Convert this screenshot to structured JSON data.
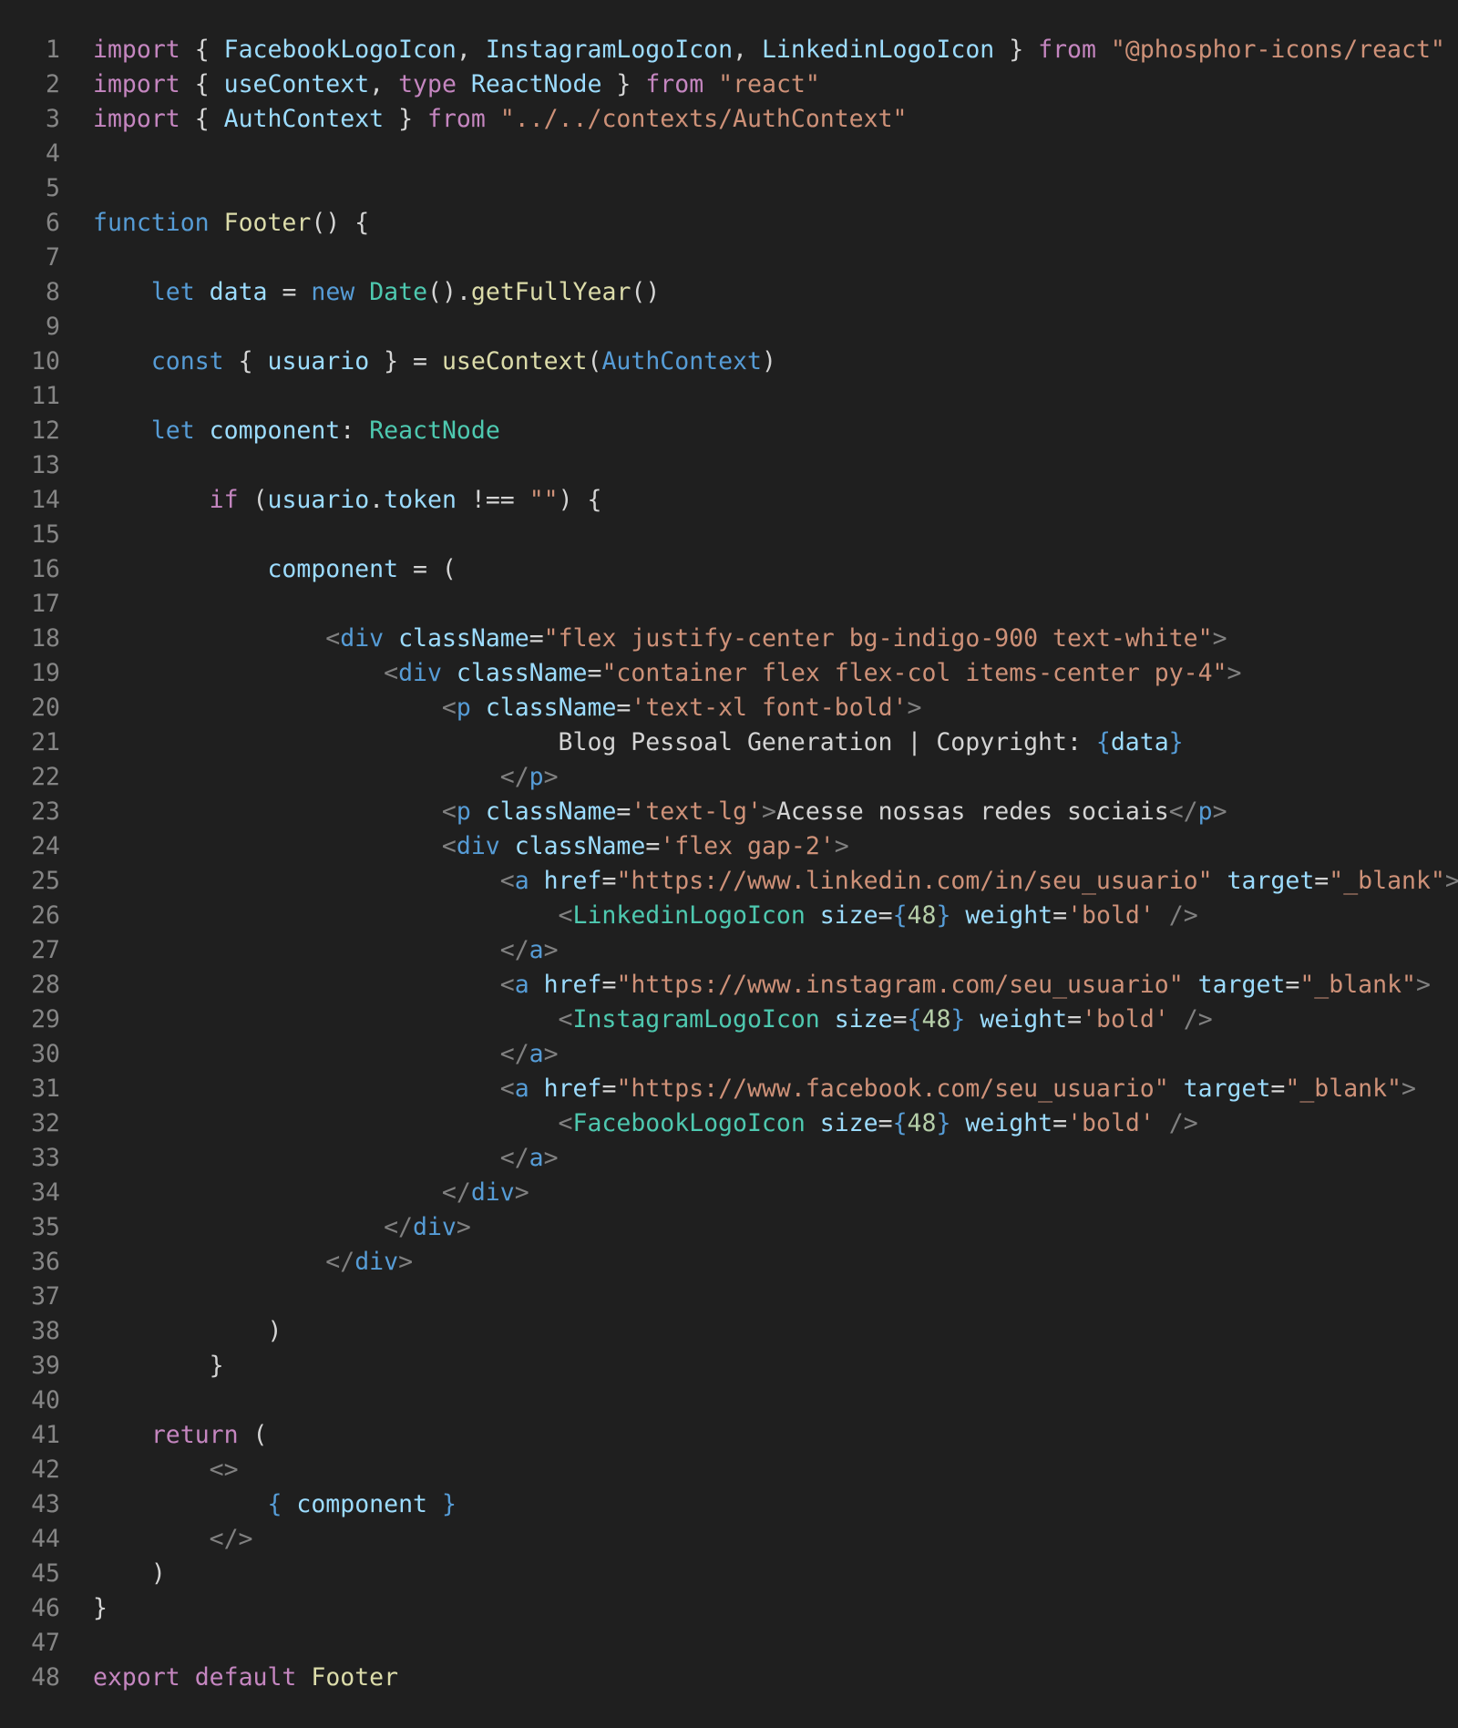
{
  "editor": {
    "theme": {
      "background": "#1f1f1f",
      "line_number": "#858585",
      "keyword_control": "#c586c0",
      "keyword_storage": "#569cd6",
      "variable": "#9cdcfe",
      "function": "#dcdcaa",
      "type": "#4ec9b0",
      "string": "#ce9178",
      "number": "#b5cea8",
      "punctuation": "#d4d4d4",
      "tag_bracket": "#808080"
    },
    "lines": [
      {
        "n": "1",
        "tokens": [
          [
            "k",
            "import"
          ],
          [
            "p",
            " { "
          ],
          [
            "v",
            "FacebookLogoIcon"
          ],
          [
            "p",
            ", "
          ],
          [
            "v",
            "InstagramLogoIcon"
          ],
          [
            "p",
            ", "
          ],
          [
            "v",
            "LinkedinLogoIcon"
          ],
          [
            "p",
            " } "
          ],
          [
            "k",
            "from"
          ],
          [
            "p",
            " "
          ],
          [
            "s",
            "\"@phosphor-icons/react\""
          ]
        ]
      },
      {
        "n": "2",
        "tokens": [
          [
            "k",
            "import"
          ],
          [
            "p",
            " { "
          ],
          [
            "v",
            "useContext"
          ],
          [
            "p",
            ", "
          ],
          [
            "k",
            "type"
          ],
          [
            "p",
            " "
          ],
          [
            "v",
            "ReactNode"
          ],
          [
            "p",
            " } "
          ],
          [
            "k",
            "from"
          ],
          [
            "p",
            " "
          ],
          [
            "s",
            "\"react\""
          ]
        ]
      },
      {
        "n": "3",
        "tokens": [
          [
            "k",
            "import"
          ],
          [
            "p",
            " { "
          ],
          [
            "v",
            "AuthContext"
          ],
          [
            "p",
            " } "
          ],
          [
            "k",
            "from"
          ],
          [
            "p",
            " "
          ],
          [
            "s",
            "\"../../contexts/AuthContext\""
          ]
        ]
      },
      {
        "n": "4",
        "tokens": []
      },
      {
        "n": "5",
        "tokens": []
      },
      {
        "n": "6",
        "tokens": [
          [
            "kb",
            "function"
          ],
          [
            "p",
            " "
          ],
          [
            "f",
            "Footer"
          ],
          [
            "p",
            "() {"
          ]
        ]
      },
      {
        "n": "7",
        "tokens": []
      },
      {
        "n": "8",
        "tokens": [
          [
            "p",
            "    "
          ],
          [
            "kb",
            "let"
          ],
          [
            "p",
            " "
          ],
          [
            "v",
            "data"
          ],
          [
            "p",
            " = "
          ],
          [
            "kb",
            "new"
          ],
          [
            "p",
            " "
          ],
          [
            "t",
            "Date"
          ],
          [
            "p",
            "()."
          ],
          [
            "f",
            "getFullYear"
          ],
          [
            "p",
            "()"
          ]
        ]
      },
      {
        "n": "9",
        "tokens": []
      },
      {
        "n": "10",
        "tokens": [
          [
            "p",
            "    "
          ],
          [
            "kb",
            "const"
          ],
          [
            "p",
            " { "
          ],
          [
            "v",
            "usuario"
          ],
          [
            "p",
            " } = "
          ],
          [
            "f",
            "useContext"
          ],
          [
            "p",
            "("
          ],
          [
            "kb",
            "AuthContext"
          ],
          [
            "p",
            ")"
          ]
        ]
      },
      {
        "n": "11",
        "tokens": []
      },
      {
        "n": "12",
        "tokens": [
          [
            "p",
            "    "
          ],
          [
            "kb",
            "let"
          ],
          [
            "p",
            " "
          ],
          [
            "v",
            "component"
          ],
          [
            "p",
            ": "
          ],
          [
            "t",
            "ReactNode"
          ]
        ]
      },
      {
        "n": "13",
        "tokens": []
      },
      {
        "n": "14",
        "tokens": [
          [
            "p",
            "        "
          ],
          [
            "k",
            "if"
          ],
          [
            "p",
            " ("
          ],
          [
            "v",
            "usuario"
          ],
          [
            "p",
            "."
          ],
          [
            "v",
            "token"
          ],
          [
            "p",
            " !== "
          ],
          [
            "s",
            "\"\""
          ],
          [
            "p",
            ") {"
          ]
        ]
      },
      {
        "n": "15",
        "tokens": []
      },
      {
        "n": "16",
        "tokens": [
          [
            "p",
            "            "
          ],
          [
            "v",
            "component"
          ],
          [
            "p",
            " = ("
          ]
        ]
      },
      {
        "n": "17",
        "tokens": []
      },
      {
        "n": "18",
        "tokens": [
          [
            "p",
            "                "
          ],
          [
            "tg",
            "<"
          ],
          [
            "tn",
            "div"
          ],
          [
            "p",
            " "
          ],
          [
            "v",
            "className"
          ],
          [
            "p",
            "="
          ],
          [
            "s",
            "\"flex justify-center bg-indigo-900 text-white\""
          ],
          [
            "tg",
            ">"
          ]
        ]
      },
      {
        "n": "19",
        "tokens": [
          [
            "p",
            "                    "
          ],
          [
            "tg",
            "<"
          ],
          [
            "tn",
            "div"
          ],
          [
            "p",
            " "
          ],
          [
            "v",
            "className"
          ],
          [
            "p",
            "="
          ],
          [
            "s",
            "\"container flex flex-col items-center py-4\""
          ],
          [
            "tg",
            ">"
          ]
        ]
      },
      {
        "n": "20",
        "tokens": [
          [
            "p",
            "                        "
          ],
          [
            "tg",
            "<"
          ],
          [
            "tn",
            "p"
          ],
          [
            "p",
            " "
          ],
          [
            "v",
            "className"
          ],
          [
            "p",
            "="
          ],
          [
            "s",
            "'text-xl font-bold'"
          ],
          [
            "tg",
            ">"
          ]
        ]
      },
      {
        "n": "21",
        "tokens": [
          [
            "p",
            "                                Blog Pessoal Generation | Copyright: "
          ],
          [
            "kb",
            "{"
          ],
          [
            "v",
            "data"
          ],
          [
            "kb",
            "}"
          ]
        ]
      },
      {
        "n": "22",
        "tokens": [
          [
            "p",
            "                            "
          ],
          [
            "tg",
            "</"
          ],
          [
            "tn",
            "p"
          ],
          [
            "tg",
            ">"
          ]
        ]
      },
      {
        "n": "23",
        "tokens": [
          [
            "p",
            "                        "
          ],
          [
            "tg",
            "<"
          ],
          [
            "tn",
            "p"
          ],
          [
            "p",
            " "
          ],
          [
            "v",
            "className"
          ],
          [
            "p",
            "="
          ],
          [
            "s",
            "'text-lg'"
          ],
          [
            "tg",
            ">"
          ],
          [
            "p",
            "Acesse nossas redes sociais"
          ],
          [
            "tg",
            "</"
          ],
          [
            "tn",
            "p"
          ],
          [
            "tg",
            ">"
          ]
        ]
      },
      {
        "n": "24",
        "tokens": [
          [
            "p",
            "                        "
          ],
          [
            "tg",
            "<"
          ],
          [
            "tn",
            "div"
          ],
          [
            "p",
            " "
          ],
          [
            "v",
            "className"
          ],
          [
            "p",
            "="
          ],
          [
            "s",
            "'flex gap-2'"
          ],
          [
            "tg",
            ">"
          ]
        ]
      },
      {
        "n": "25",
        "tokens": [
          [
            "p",
            "                            "
          ],
          [
            "tg",
            "<"
          ],
          [
            "tn",
            "a"
          ],
          [
            "p",
            " "
          ],
          [
            "v",
            "href"
          ],
          [
            "p",
            "="
          ],
          [
            "s",
            "\"https://www.linkedin.com/in/seu_usuario\""
          ],
          [
            "p",
            " "
          ],
          [
            "v",
            "target"
          ],
          [
            "p",
            "="
          ],
          [
            "s",
            "\"_blank\""
          ],
          [
            "tg",
            ">"
          ]
        ]
      },
      {
        "n": "26",
        "tokens": [
          [
            "p",
            "                                "
          ],
          [
            "tg",
            "<"
          ],
          [
            "t",
            "LinkedinLogoIcon"
          ],
          [
            "p",
            " "
          ],
          [
            "v",
            "size"
          ],
          [
            "p",
            "="
          ],
          [
            "kb",
            "{"
          ],
          [
            "n",
            "48"
          ],
          [
            "kb",
            "}"
          ],
          [
            "p",
            " "
          ],
          [
            "v",
            "weight"
          ],
          [
            "p",
            "="
          ],
          [
            "s",
            "'bold'"
          ],
          [
            "p",
            " "
          ],
          [
            "tg",
            "/>"
          ]
        ]
      },
      {
        "n": "27",
        "tokens": [
          [
            "p",
            "                            "
          ],
          [
            "tg",
            "</"
          ],
          [
            "tn",
            "a"
          ],
          [
            "tg",
            ">"
          ]
        ]
      },
      {
        "n": "28",
        "tokens": [
          [
            "p",
            "                            "
          ],
          [
            "tg",
            "<"
          ],
          [
            "tn",
            "a"
          ],
          [
            "p",
            " "
          ],
          [
            "v",
            "href"
          ],
          [
            "p",
            "="
          ],
          [
            "s",
            "\"https://www.instagram.com/seu_usuario\""
          ],
          [
            "p",
            " "
          ],
          [
            "v",
            "target"
          ],
          [
            "p",
            "="
          ],
          [
            "s",
            "\"_blank\""
          ],
          [
            "tg",
            ">"
          ]
        ]
      },
      {
        "n": "29",
        "tokens": [
          [
            "p",
            "                                "
          ],
          [
            "tg",
            "<"
          ],
          [
            "t",
            "InstagramLogoIcon"
          ],
          [
            "p",
            " "
          ],
          [
            "v",
            "size"
          ],
          [
            "p",
            "="
          ],
          [
            "kb",
            "{"
          ],
          [
            "n",
            "48"
          ],
          [
            "kb",
            "}"
          ],
          [
            "p",
            " "
          ],
          [
            "v",
            "weight"
          ],
          [
            "p",
            "="
          ],
          [
            "s",
            "'bold'"
          ],
          [
            "p",
            " "
          ],
          [
            "tg",
            "/>"
          ]
        ]
      },
      {
        "n": "30",
        "tokens": [
          [
            "p",
            "                            "
          ],
          [
            "tg",
            "</"
          ],
          [
            "tn",
            "a"
          ],
          [
            "tg",
            ">"
          ]
        ]
      },
      {
        "n": "31",
        "tokens": [
          [
            "p",
            "                            "
          ],
          [
            "tg",
            "<"
          ],
          [
            "tn",
            "a"
          ],
          [
            "p",
            " "
          ],
          [
            "v",
            "href"
          ],
          [
            "p",
            "="
          ],
          [
            "s",
            "\"https://www.facebook.com/seu_usuario\""
          ],
          [
            "p",
            " "
          ],
          [
            "v",
            "target"
          ],
          [
            "p",
            "="
          ],
          [
            "s",
            "\"_blank\""
          ],
          [
            "tg",
            ">"
          ]
        ]
      },
      {
        "n": "32",
        "tokens": [
          [
            "p",
            "                                "
          ],
          [
            "tg",
            "<"
          ],
          [
            "t",
            "FacebookLogoIcon"
          ],
          [
            "p",
            " "
          ],
          [
            "v",
            "size"
          ],
          [
            "p",
            "="
          ],
          [
            "kb",
            "{"
          ],
          [
            "n",
            "48"
          ],
          [
            "kb",
            "}"
          ],
          [
            "p",
            " "
          ],
          [
            "v",
            "weight"
          ],
          [
            "p",
            "="
          ],
          [
            "s",
            "'bold'"
          ],
          [
            "p",
            " "
          ],
          [
            "tg",
            "/>"
          ]
        ]
      },
      {
        "n": "33",
        "tokens": [
          [
            "p",
            "                            "
          ],
          [
            "tg",
            "</"
          ],
          [
            "tn",
            "a"
          ],
          [
            "tg",
            ">"
          ]
        ]
      },
      {
        "n": "34",
        "tokens": [
          [
            "p",
            "                        "
          ],
          [
            "tg",
            "</"
          ],
          [
            "tn",
            "div"
          ],
          [
            "tg",
            ">"
          ]
        ]
      },
      {
        "n": "35",
        "tokens": [
          [
            "p",
            "                    "
          ],
          [
            "tg",
            "</"
          ],
          [
            "tn",
            "div"
          ],
          [
            "tg",
            ">"
          ]
        ]
      },
      {
        "n": "36",
        "tokens": [
          [
            "p",
            "                "
          ],
          [
            "tg",
            "</"
          ],
          [
            "tn",
            "div"
          ],
          [
            "tg",
            ">"
          ]
        ]
      },
      {
        "n": "37",
        "tokens": []
      },
      {
        "n": "38",
        "tokens": [
          [
            "p",
            "            )"
          ]
        ]
      },
      {
        "n": "39",
        "tokens": [
          [
            "p",
            "        }"
          ]
        ]
      },
      {
        "n": "40",
        "tokens": []
      },
      {
        "n": "41",
        "tokens": [
          [
            "p",
            "    "
          ],
          [
            "k",
            "return"
          ],
          [
            "p",
            " ("
          ]
        ]
      },
      {
        "n": "42",
        "tokens": [
          [
            "p",
            "        "
          ],
          [
            "tg",
            "<>"
          ]
        ]
      },
      {
        "n": "43",
        "tokens": [
          [
            "p",
            "            "
          ],
          [
            "kb",
            "{"
          ],
          [
            "p",
            " "
          ],
          [
            "v",
            "component"
          ],
          [
            "p",
            " "
          ],
          [
            "kb",
            "}"
          ]
        ]
      },
      {
        "n": "44",
        "tokens": [
          [
            "p",
            "        "
          ],
          [
            "tg",
            "</>"
          ]
        ]
      },
      {
        "n": "45",
        "tokens": [
          [
            "p",
            "    )"
          ]
        ]
      },
      {
        "n": "46",
        "tokens": [
          [
            "p",
            "}"
          ]
        ]
      },
      {
        "n": "47",
        "tokens": []
      },
      {
        "n": "48",
        "tokens": [
          [
            "k",
            "export"
          ],
          [
            "p",
            " "
          ],
          [
            "k",
            "default"
          ],
          [
            "p",
            " "
          ],
          [
            "f",
            "Footer"
          ]
        ]
      }
    ]
  }
}
